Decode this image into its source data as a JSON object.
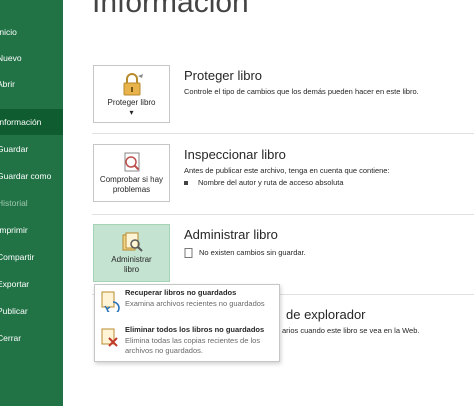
{
  "sidebar": {
    "items": [
      {
        "label": "Inicio"
      },
      {
        "label": "Nuevo"
      },
      {
        "label": "Abrir"
      },
      {
        "label": "Información"
      },
      {
        "label": "Guardar"
      },
      {
        "label": "Guardar como"
      },
      {
        "label": "Historial"
      },
      {
        "label": "Imprimir"
      },
      {
        "label": "Compartir"
      },
      {
        "label": "Exportar"
      },
      {
        "label": "Publicar"
      },
      {
        "label": "Cerrar"
      }
    ]
  },
  "page": {
    "title": "Información"
  },
  "protect": {
    "button": "Proteger libro",
    "title": "Proteger libro",
    "description": "Controle el tipo de cambios que los demás pueden hacer en este libro."
  },
  "inspect": {
    "button_line1": "Comprobar si hay",
    "button_line2": "problemas",
    "title": "Inspeccionar libro",
    "description": "Antes de publicar este archivo, tenga en cuenta que contiene:",
    "bullet": "Nombre del autor y ruta de acceso absoluta"
  },
  "manage": {
    "button_line1": "Administrar",
    "button_line2": "libro",
    "title": "Administrar libro",
    "bullet": "No existen cambios sin guardar."
  },
  "browser": {
    "title_partial": "de explorador",
    "desc_partial": "arios cuando este libro se vea en la Web."
  },
  "dropdown": {
    "items": [
      {
        "title": "Recuperar libros no guardados",
        "desc": "Examina archivos recientes no guardados"
      },
      {
        "title": "Eliminar todos los libros no guardados",
        "desc": "Elimina todas las copias recientes de los archivos no guardados."
      }
    ]
  },
  "colors": {
    "accent": "#217346",
    "selected_nav": "#0e5c2f",
    "selected_button": "#c5e3d1"
  }
}
